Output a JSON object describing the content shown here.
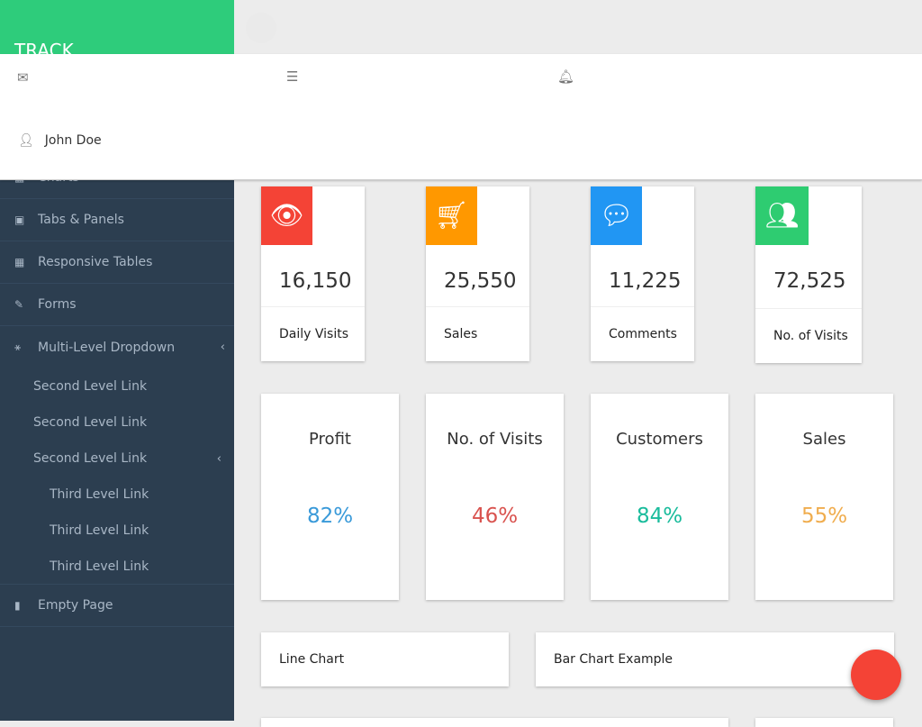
{
  "brand": "TRACK",
  "user": {
    "name": "John Doe"
  },
  "nav": [
    {
      "label": "Charts",
      "icon": "bar-chart-icon"
    },
    {
      "label": "Tabs & Panels",
      "icon": "qrcode-icon"
    },
    {
      "label": "Responsive Tables",
      "icon": "table-icon"
    },
    {
      "label": "Forms",
      "icon": "edit-icon"
    },
    {
      "label": "Multi-Level Dropdown",
      "icon": "sitemap-icon"
    }
  ],
  "sub": [
    "Second Level Link",
    "Second Level Link",
    "Second Level Link"
  ],
  "third": [
    "Third Level Link",
    "Third Level Link",
    "Third Level Link"
  ],
  "empty": "Empty Page",
  "stats": [
    {
      "value": "16,150",
      "label": "Daily Visits",
      "color": "#f44336",
      "icon": "eye-icon"
    },
    {
      "value": "25,550",
      "label": "Sales",
      "color": "#ff9800",
      "icon": "shopping-cart-icon"
    },
    {
      "value": "11,225",
      "label": "Comments",
      "color": "#2196f3",
      "icon": "comments-icon"
    },
    {
      "value": "72,525",
      "label": "No. of Visits",
      "color": "#2ecc71",
      "icon": "users-icon"
    }
  ],
  "percents": [
    {
      "title": "Profit",
      "value": "82%",
      "color": "#3a9ad9"
    },
    {
      "title": "No. of Visits",
      "value": "46%",
      "color": "#d9534f"
    },
    {
      "title": "Customers",
      "value": "84%",
      "color": "#1abc9c"
    },
    {
      "title": "Sales",
      "value": "55%",
      "color": "#f0ad4e"
    }
  ],
  "charts": {
    "line": "Line Chart",
    "bar": "Bar Chart Example"
  }
}
